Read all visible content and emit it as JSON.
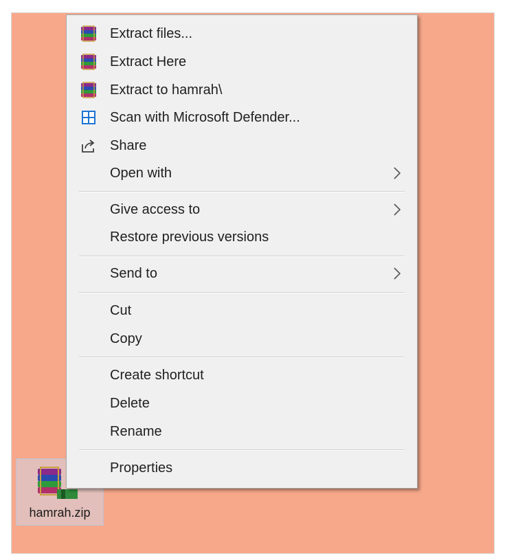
{
  "context_menu": {
    "items": [
      {
        "label": "Extract files...",
        "icon": "winrar-icon"
      },
      {
        "label": "Extract Here",
        "icon": "winrar-icon"
      },
      {
        "label": "Extract to hamrah\\",
        "icon": "winrar-icon"
      },
      {
        "label": "Scan with Microsoft Defender...",
        "icon": "defender-shield-icon"
      },
      {
        "label": "Share",
        "icon": "share-icon"
      },
      {
        "label": "Open with",
        "submenu": true
      },
      {
        "label": "Give access to",
        "submenu": true
      },
      {
        "label": "Restore previous versions"
      },
      {
        "label": "Send to",
        "submenu": true
      },
      {
        "label": "Cut"
      },
      {
        "label": "Copy"
      },
      {
        "label": "Create shortcut"
      },
      {
        "label": "Delete"
      },
      {
        "label": "Rename"
      },
      {
        "label": "Properties"
      }
    ]
  },
  "desktop": {
    "background_color": "#f7a88a",
    "file": {
      "name": "hamrah.zip",
      "icon": "winrar-archive-icon"
    }
  }
}
